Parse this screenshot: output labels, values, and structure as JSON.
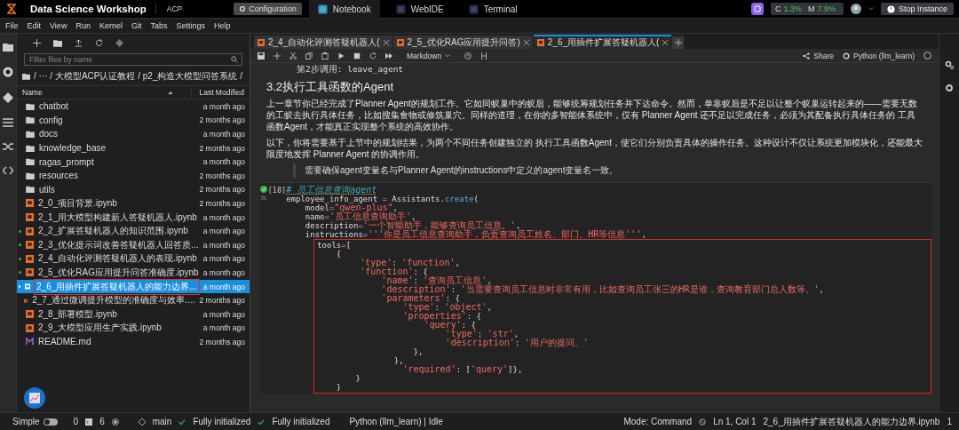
{
  "topbar": {
    "app_title": "Data Science Workshop",
    "workspace": "ACP",
    "configuration_button": "Configuration",
    "nav_tabs": [
      {
        "label": "Notebook",
        "selected": true
      },
      {
        "label": "WebIDE",
        "selected": false
      },
      {
        "label": "Terminal",
        "selected": false
      }
    ],
    "cpu_label": "C",
    "cpu_value": "1.3%",
    "mem_label": "M",
    "mem_value": "7.9%",
    "stop_button": "Stop Instance"
  },
  "menu": [
    "File",
    "Edit",
    "View",
    "Run",
    "Kernel",
    "Git",
    "Tabs",
    "Settings",
    "Help"
  ],
  "file_browser": {
    "filter_placeholder": "Filter files by name",
    "breadcrumb": "/  ···  / 大模型ACP认证教程 / p2_构造大模型问答系统 /",
    "columns": [
      "Name",
      "Last Modified"
    ],
    "items": [
      {
        "kind": "folder",
        "name": "chatbot",
        "modified": "a month ago",
        "running": false,
        "selected": false
      },
      {
        "kind": "folder",
        "name": "config",
        "modified": "2 months ago",
        "running": false,
        "selected": false
      },
      {
        "kind": "folder",
        "name": "docs",
        "modified": "a month ago",
        "running": false,
        "selected": false
      },
      {
        "kind": "folder",
        "name": "knowledge_base",
        "modified": "2 months ago",
        "running": false,
        "selected": false
      },
      {
        "kind": "folder",
        "name": "ragas_prompt",
        "modified": "a month ago",
        "running": false,
        "selected": false
      },
      {
        "kind": "folder",
        "name": "resources",
        "modified": "2 months ago",
        "running": false,
        "selected": false
      },
      {
        "kind": "folder",
        "name": "utils",
        "modified": "2 months ago",
        "running": false,
        "selected": false
      },
      {
        "kind": "notebook",
        "name": "2_0_项目背景.ipynb",
        "modified": "2 months ago",
        "running": false,
        "selected": false
      },
      {
        "kind": "notebook",
        "name": "2_1_用大模型构建新人答疑机器人.ipynb",
        "modified": "a month ago",
        "running": false,
        "selected": false
      },
      {
        "kind": "notebook",
        "name": "2_2_扩展答疑机器人的知识范围.ipynb",
        "modified": "a month ago",
        "running": true,
        "selected": false
      },
      {
        "kind": "notebook",
        "name": "2_3_优化提示词改善答疑机器人回答质...",
        "modified": "a month ago",
        "running": true,
        "selected": false
      },
      {
        "kind": "notebook",
        "name": "2_4_自动化评测答疑机器人的表现.ipynb",
        "modified": "a month ago",
        "running": true,
        "selected": false
      },
      {
        "kind": "notebook",
        "name": "2_5_优化RAG应用提升问答准确度.ipynb",
        "modified": "a month ago",
        "running": true,
        "selected": false
      },
      {
        "kind": "notebook",
        "name": "2_6_用插件扩展答疑机器人的能力边界...",
        "modified": "a month ago",
        "running": true,
        "selected": true
      },
      {
        "kind": "notebook",
        "name": "2_7_通过微调提升模型的准确度与效率....",
        "modified": "2 months ago",
        "running": false,
        "selected": false
      },
      {
        "kind": "notebook",
        "name": "2_8_部署模型.ipynb",
        "modified": "a month ago",
        "running": false,
        "selected": false
      },
      {
        "kind": "notebook",
        "name": "2_9_大模型应用生产实践.ipynb",
        "modified": "a month ago",
        "running": false,
        "selected": false
      },
      {
        "kind": "markdown",
        "name": "README.md",
        "modified": "2 months ago",
        "running": false,
        "selected": false
      }
    ]
  },
  "doc_tabs": [
    {
      "label": "2_4_自动化评测答疑机器人(",
      "selected": false
    },
    {
      "label": "2_5_优化RAG应用提升问答)",
      "selected": false
    },
    {
      "label": "2_6_用插件扩展答疑机器人(",
      "selected": true
    }
  ],
  "toolbar": {
    "cell_type": "Markdown",
    "share": "Share",
    "kernel": "Python (llm_learn)"
  },
  "notebook": {
    "prev_output": "第2步调用: leave_agent",
    "heading": "3.2执行工具函数的Agent",
    "paragraphs": [
      "上一章节你已经完成了Planner Agent的规划工作。它如同蚁巢中的蚁后，能够统筹规划任务并下达命令。然而，单靠蚁后是不足以让整个蚁巢运转起来的——需要无数的工蚁去执行具体任务，比如搜集食物或修筑巢穴。同样的道理，在你的多智能体系统中，仅有 Planner Agent 还不足以完成任务，必须为其配备执行具体任务的 工具函数Agent，才能真正实现整个系统的高效协作。",
      "以下，你将需要基于上节中的规划结果，为两个不同任务创建独立的 执行工具函数Agent，使它们分别负责具体的操作任务。这种设计不仅让系统更加模块化，还能最大限度地发挥 Planner Agent 的协调作用。"
    ],
    "quote": "需要确保agent变量名与Planner Agent的instructions中定义的agent变量名一致。",
    "code_cell": {
      "prompt": "[18]",
      "time": "0s",
      "lines": [
        [
          {
            "kind": "comment",
            "text": "# 员工信息查询agent"
          }
        ],
        [
          {
            "kind": "plain",
            "text": "employee_info_agent "
          },
          {
            "kind": "op",
            "text": "="
          },
          {
            "kind": "plain",
            "text": " Assistants."
          },
          {
            "kind": "call",
            "text": "create"
          },
          {
            "kind": "plain",
            "text": "("
          }
        ],
        [
          {
            "kind": "plain",
            "text": "    model"
          },
          {
            "kind": "op",
            "text": "="
          },
          {
            "kind": "str",
            "text": "\"qwen-plus\""
          },
          {
            "kind": "plain",
            "text": ","
          }
        ],
        [
          {
            "kind": "plain",
            "text": "    name"
          },
          {
            "kind": "op",
            "text": "="
          },
          {
            "kind": "str",
            "text": "'员工信息查询助手'"
          },
          {
            "kind": "plain",
            "text": ","
          }
        ],
        [
          {
            "kind": "plain",
            "text": "    description"
          },
          {
            "kind": "op",
            "text": "="
          },
          {
            "kind": "str",
            "text": "'一个智能助手，能够查询员工信息。'"
          },
          {
            "kind": "plain",
            "text": ","
          }
        ],
        [
          {
            "kind": "plain",
            "text": "    instructions"
          },
          {
            "kind": "op",
            "text": "="
          },
          {
            "kind": "str",
            "text": "'''你是员工信息查询助手，负责查询员工姓名、部门、HR等信息'''"
          },
          {
            "kind": "plain",
            "text": ","
          }
        ]
      ],
      "boxed_lines": [
        [
          {
            "kind": "plain",
            "text": "tools"
          },
          {
            "kind": "op",
            "text": "="
          },
          {
            "kind": "plain",
            "text": "["
          }
        ],
        [
          {
            "kind": "plain",
            "text": "    {"
          }
        ],
        [
          {
            "kind": "str",
            "text": "        'type'"
          },
          {
            "kind": "plain",
            "text": ": "
          },
          {
            "kind": "str",
            "text": "'function'"
          },
          {
            "kind": "plain",
            "text": ","
          }
        ],
        [
          {
            "kind": "str",
            "text": "        'function'"
          },
          {
            "kind": "plain",
            "text": ": {"
          }
        ],
        [
          {
            "kind": "str",
            "text": "            'name'"
          },
          {
            "kind": "plain",
            "text": ": "
          },
          {
            "kind": "str",
            "text": "'查询员工信息'"
          },
          {
            "kind": "plain",
            "text": ","
          }
        ],
        [
          {
            "kind": "str",
            "text": "            'description'"
          },
          {
            "kind": "plain",
            "text": ": "
          },
          {
            "kind": "str",
            "text": "'当需要查询员工信息时非常有用，比如查询员工张三的HR是谁，查询教育部门总人数等。'"
          },
          {
            "kind": "plain",
            "text": ","
          }
        ],
        [
          {
            "kind": "str",
            "text": "            'parameters'"
          },
          {
            "kind": "plain",
            "text": ": {"
          }
        ],
        [
          {
            "kind": "str",
            "text": "                'type'"
          },
          {
            "kind": "plain",
            "text": ": "
          },
          {
            "kind": "str",
            "text": "'object'"
          },
          {
            "kind": "plain",
            "text": ","
          }
        ],
        [
          {
            "kind": "str",
            "text": "                'properties'"
          },
          {
            "kind": "plain",
            "text": ": {"
          }
        ],
        [
          {
            "kind": "str",
            "text": "                    'query'"
          },
          {
            "kind": "plain",
            "text": ": {"
          }
        ],
        [
          {
            "kind": "str",
            "text": "                        'type'"
          },
          {
            "kind": "plain",
            "text": ": "
          },
          {
            "kind": "str",
            "text": "'str'"
          },
          {
            "kind": "plain",
            "text": ","
          }
        ],
        [
          {
            "kind": "str",
            "text": "                        'description'"
          },
          {
            "kind": "plain",
            "text": ": "
          },
          {
            "kind": "str",
            "text": "'用户的提问。'"
          }
        ],
        [
          {
            "kind": "plain",
            "text": "                    },"
          }
        ],
        [
          {
            "kind": "plain",
            "text": "                },"
          }
        ],
        [
          {
            "kind": "str",
            "text": "                'required'"
          },
          {
            "kind": "plain",
            "text": ": ["
          },
          {
            "kind": "str",
            "text": "'query'"
          },
          {
            "kind": "plain",
            "text": "]},"
          }
        ],
        [
          {
            "kind": "plain",
            "text": "        }"
          }
        ],
        [
          {
            "kind": "plain",
            "text": "    }"
          }
        ]
      ]
    }
  },
  "status_bar": {
    "mode_label": "Simple",
    "simple_on": false,
    "terminals": "0",
    "kernels": "6",
    "branch": "main",
    "git_status": "Fully initialized",
    "lsp_status": "Fully initialized",
    "kernel_status": "Python (llm_learn) | Idle",
    "mode": "Mode: Command",
    "position": "Ln 1, Col 1",
    "file": "2_6_用插件扩展答疑机器人的能力边界.ipynb",
    "count": "1"
  }
}
